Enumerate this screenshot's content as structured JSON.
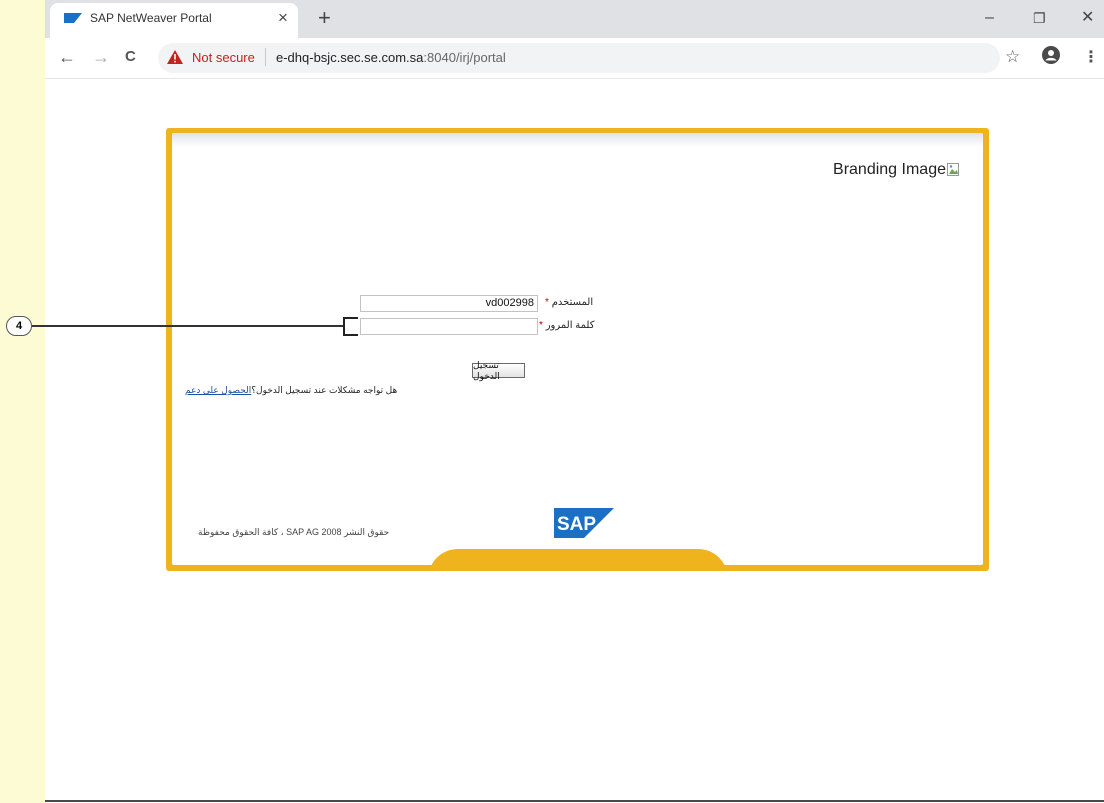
{
  "browser": {
    "tab_title": "SAP NetWeaver Portal",
    "tab_close": "×",
    "new_tab": "+",
    "minimize": "–",
    "restore": "❐",
    "close": "✕",
    "back": "←",
    "forward": "→",
    "reload": "C",
    "security_label": "Not secure",
    "url_host": "e-dhq-bsjc.sec.se.com.sa",
    "url_rest": ":8040/irj/portal",
    "bookmark": "☆",
    "menu": "⋮"
  },
  "portal": {
    "branding_text": "Branding Image",
    "username_label": "المستخدم",
    "username_value": "vd002998",
    "password_label": "كلمة المرور",
    "required_mark": "*",
    "logon_button": "تسجيل الدخول",
    "help_text": "هل تواجه مشكلات عند تسجيل الدخول؟",
    "help_link": "الحصول على دعم",
    "copyright": "حقوق النشر SAP AG 2008 ، كافة الحقوق محفوظة",
    "logo_text": "SAP"
  },
  "callout": {
    "number": "4"
  },
  "colors": {
    "frame": "#efb31d",
    "required": "#c00000",
    "not_secure": "#c5221f",
    "sap_blue": "#1a70c5"
  }
}
